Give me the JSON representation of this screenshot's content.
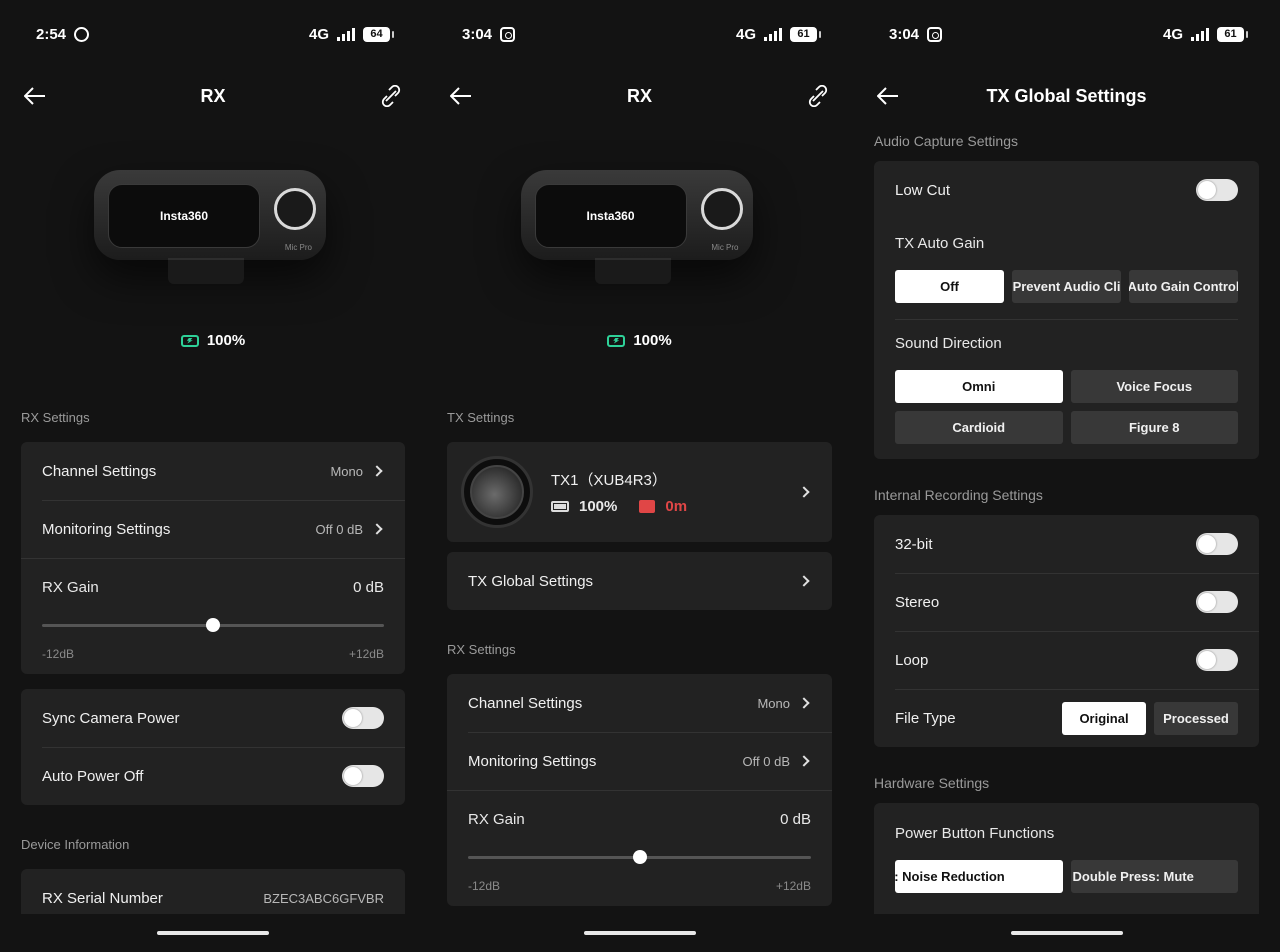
{
  "screen1": {
    "status": {
      "time": "2:54",
      "network": "4G",
      "battery": "64"
    },
    "nav": {
      "title": "RX"
    },
    "device_brand": "Insta360",
    "device_tag": "Mic Pro",
    "battery_level": "100%",
    "rx_settings_label": "RX Settings",
    "channel_settings": {
      "label": "Channel Settings",
      "value": "Mono"
    },
    "monitoring_settings": {
      "label": "Monitoring Settings",
      "value": "Off 0 dB"
    },
    "rx_gain": {
      "label": "RX Gain",
      "value": "0 dB",
      "min": "-12dB",
      "max": "+12dB",
      "level": 0.5
    },
    "sync_camera_power": "Sync Camera Power",
    "auto_power_off": "Auto Power Off",
    "device_info_label": "Device Information",
    "serial": {
      "label": "RX Serial Number",
      "value": "BZEC3ABC6GFVBR"
    }
  },
  "screen2": {
    "status": {
      "time": "3:04",
      "network": "4G",
      "battery": "61"
    },
    "nav": {
      "title": "RX"
    },
    "device_brand": "Insta360",
    "device_tag": "Mic Pro",
    "battery_level": "100%",
    "tx_settings_label": "TX Settings",
    "tx1": {
      "name": "TX1（XUB4R3）",
      "battery": "100%",
      "record_time": "0m"
    },
    "tx_global_settings": "TX Global Settings",
    "rx_settings_label": "RX Settings",
    "channel_settings": {
      "label": "Channel Settings",
      "value": "Mono"
    },
    "monitoring_settings": {
      "label": "Monitoring Settings",
      "value": "Off 0 dB"
    },
    "rx_gain": {
      "label": "RX Gain",
      "value": "0 dB",
      "min": "-12dB",
      "max": "+12dB",
      "level": 0.5
    }
  },
  "screen3": {
    "status": {
      "time": "3:04",
      "network": "4G",
      "battery": "61"
    },
    "nav": {
      "title": "TX Global Settings"
    },
    "audio_capture_label": "Audio Capture Settings",
    "low_cut": "Low Cut",
    "tx_auto_gain": {
      "label": "TX Auto Gain",
      "options": [
        "Off",
        "Prevent Audio Cli",
        "Auto Gain Control"
      ],
      "selected": "Off"
    },
    "sound_direction": {
      "label": "Sound Direction",
      "options": [
        "Omni",
        "Voice Focus",
        "Cardioid",
        "Figure 8"
      ],
      "selected": "Omni"
    },
    "internal_recording_label": "Internal Recording Settings",
    "bit32": "32-bit",
    "stereo": "Stereo",
    "loop": "Loop",
    "file_type": {
      "label": "File Type",
      "options": [
        "Original",
        "Processed"
      ],
      "selected": "Original"
    },
    "hardware_label": "Hardware Settings",
    "power_button": {
      "label": "Power Button Functions",
      "options": [
        "s: Noise Reduction",
        "Double Press: Mute"
      ]
    }
  },
  "colors": {
    "accent_green": "#2ed198",
    "record_red": "#e04646",
    "card": "#222222",
    "background": "#131313"
  }
}
